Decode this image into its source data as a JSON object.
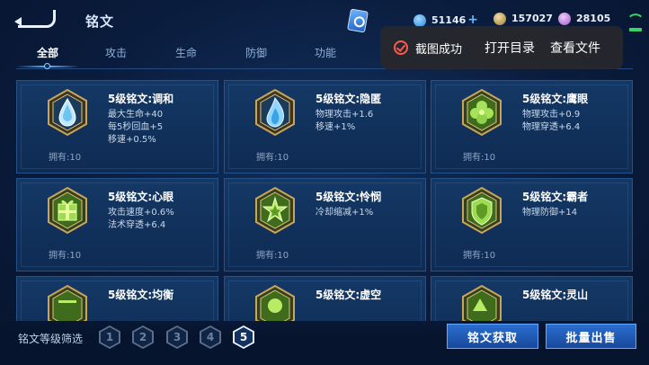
{
  "header": {
    "title": "铭文",
    "currencies": [
      {
        "icon": "diamond-coin-icon",
        "value": "51146",
        "plus": "+"
      },
      {
        "icon": "gold-coin-icon",
        "value": "157027"
      },
      {
        "icon": "crystal-coin-icon",
        "value": "28105"
      }
    ]
  },
  "tabs": [
    "全部",
    "攻击",
    "生命",
    "防御",
    "功能"
  ],
  "active_tab": "全部",
  "toast": {
    "message": "截图成功",
    "open_dir": "打开目录",
    "view_file": "查看文件"
  },
  "cards": [
    {
      "name": "5级铭文:调和",
      "stats": [
        "最大生命+40",
        "每5秒回血+5",
        "移速+0.5%"
      ],
      "owned": "拥有:10",
      "color": "blue",
      "icon": "water-drop-emblem-icon"
    },
    {
      "name": "5级铭文:隐匿",
      "stats": [
        "物理攻击+1.6",
        "移速+1%"
      ],
      "owned": "拥有:10",
      "color": "blue",
      "icon": "flame-emblem-icon"
    },
    {
      "name": "5级铭文:鹰眼",
      "stats": [
        "物理攻击+0.9",
        "物理穿透+6.4"
      ],
      "owned": "拥有:10",
      "color": "green",
      "icon": "clover-emblem-icon"
    },
    {
      "name": "5级铭文:心眼",
      "stats": [
        "攻击速度+0.6%",
        "法术穿透+6.4"
      ],
      "owned": "拥有:10",
      "color": "green",
      "icon": "gift-emblem-icon"
    },
    {
      "name": "5级铭文:怜悯",
      "stats": [
        "冷却缩减+1%"
      ],
      "owned": "拥有:10",
      "color": "green",
      "icon": "star-emblem-icon"
    },
    {
      "name": "5级铭文:霸者",
      "stats": [
        "物理防御+14"
      ],
      "owned": "拥有:10",
      "color": "green",
      "icon": "shield-emblem-icon"
    },
    {
      "name": "5级铭文:均衡",
      "stats": [],
      "owned": "",
      "color": "green",
      "icon": "balance-emblem-icon"
    },
    {
      "name": "5级铭文:虚空",
      "stats": [],
      "owned": "",
      "color": "green",
      "icon": "void-emblem-icon"
    },
    {
      "name": "5级铭文:灵山",
      "stats": [],
      "owned": "",
      "color": "green",
      "icon": "mountain-emblem-icon"
    }
  ],
  "footer": {
    "filter_label": "铭文等级筛选",
    "levels": [
      "1",
      "2",
      "3",
      "4",
      "5"
    ],
    "active_level": "5",
    "acquire_button": "铭文获取",
    "bulk_sell_button": "批量出售"
  },
  "colors": {
    "accent": "#2a6fd0",
    "toast_bg": "#28282c",
    "toast_icon": "#ff5a4e",
    "gold": "#c9a55a"
  }
}
